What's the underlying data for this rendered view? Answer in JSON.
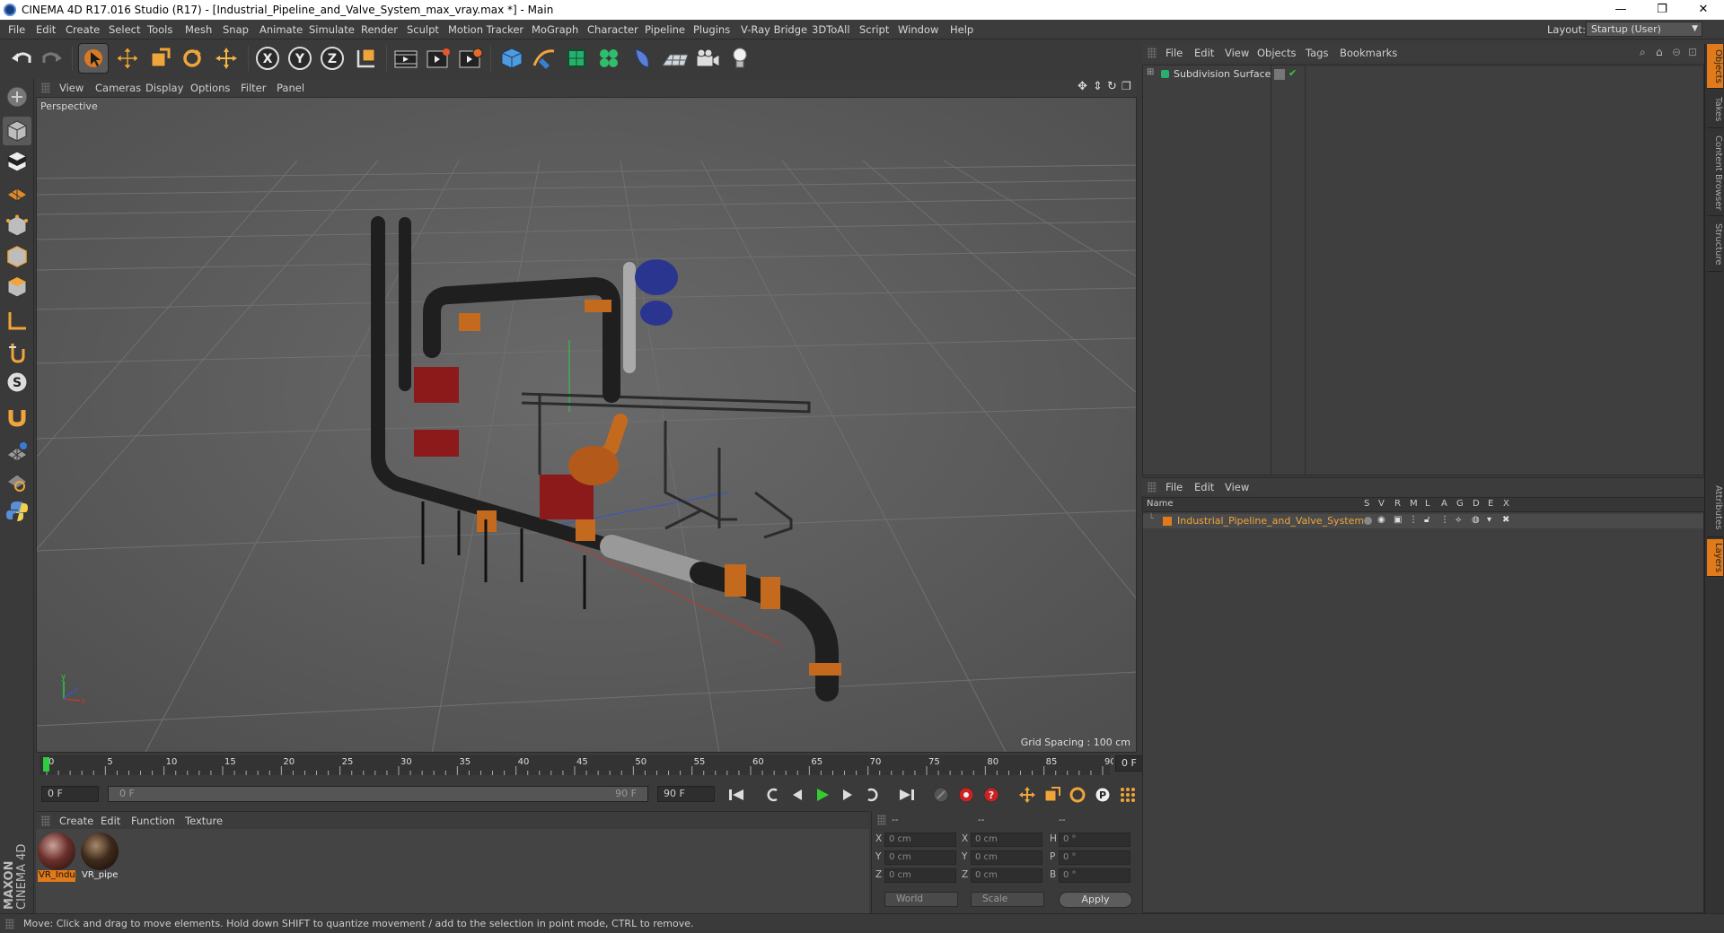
{
  "window": {
    "title": "CINEMA 4D R17.016 Studio (R17) - [Industrial_Pipeline_and_Valve_System_max_vray.max *] - Main",
    "minimize": "—",
    "restore": "❐",
    "close": "✕"
  },
  "menubar": {
    "items": [
      "File",
      "Edit",
      "Create",
      "Select",
      "Tools",
      "Mesh",
      "Snap",
      "Animate",
      "Simulate",
      "Render",
      "Sculpt",
      "Motion Tracker",
      "MoGraph",
      "Character",
      "Pipeline",
      "Plugins",
      "V-Ray Bridge",
      "3DToAll",
      "Script",
      "Window",
      "Help"
    ],
    "layout_label": "Layout:",
    "layout_value": "Startup (User)"
  },
  "toolbar": {
    "icons": [
      "undo-icon",
      "redo-icon",
      "select-arrow-icon",
      "move-icon",
      "scale-icon",
      "rotate-icon",
      "live-selection-icon",
      "x-axis-icon",
      "y-axis-icon",
      "z-axis-icon",
      "coordinate-system-icon",
      "render-view-icon",
      "render-picture-viewer-icon",
      "edit-render-settings-icon",
      "cube-icon",
      "pen-spline-icon",
      "subdivision-nurbs-icon",
      "cloner-icon",
      "deformer-icon",
      "floor-environment-icon",
      "camera-icon",
      "light-icon"
    ],
    "axis_labels": [
      "X",
      "Y",
      "Z"
    ]
  },
  "viewport": {
    "menu": [
      "View",
      "Cameras",
      "Display",
      "Options",
      "Filter",
      "Panel"
    ],
    "camera_label": "Perspective",
    "grid_spacing": "Grid Spacing : 100 cm"
  },
  "timeline": {
    "ticks": [
      "0",
      "5",
      "10",
      "15",
      "20",
      "25",
      "30",
      "35",
      "40",
      "45",
      "50",
      "55",
      "60",
      "65",
      "70",
      "75",
      "80",
      "85",
      "90"
    ],
    "current_frame_right": "0 F",
    "start_frame": "0 F",
    "range_start": "0 F",
    "range_end": "90 F",
    "end_frame": "90 F"
  },
  "materials": {
    "menu": [
      "Create",
      "Edit",
      "Function",
      "Texture"
    ],
    "items": [
      {
        "label": "VR_Indu",
        "color": "#6b2f2a"
      },
      {
        "label": "VR_pipe",
        "color": "#3e2a1c"
      }
    ]
  },
  "coordinates": {
    "headers": [
      "--",
      "--",
      "--"
    ],
    "rows": [
      {
        "l1": "X",
        "v1": "0 cm",
        "l2": "X",
        "v2": "0 cm",
        "l3": "H",
        "v3": "0 °"
      },
      {
        "l1": "Y",
        "v1": "0 cm",
        "l2": "Y",
        "v2": "0 cm",
        "l3": "P",
        "v3": "0 °"
      },
      {
        "l1": "Z",
        "v1": "0 cm",
        "l2": "Z",
        "v2": "0 cm",
        "l3": "B",
        "v3": "0 °"
      }
    ],
    "world": "World",
    "scale": "Scale",
    "apply": "Apply"
  },
  "objects_panel": {
    "menu": [
      "File",
      "Edit",
      "View",
      "Objects",
      "Tags",
      "Bookmarks"
    ],
    "items": [
      {
        "name": "Subdivision Surface"
      }
    ]
  },
  "layers_panel": {
    "menu": [
      "File",
      "Edit",
      "View"
    ],
    "columns": [
      "Name",
      "S",
      "V",
      "R",
      "M",
      "L",
      "A",
      "G",
      "D",
      "E",
      "X"
    ],
    "items": [
      {
        "name": "Industrial_Pipeline_and_Valve_System",
        "color": "#e07a1a"
      }
    ]
  },
  "side_tabs": [
    "Objects",
    "Takes",
    "Content Browser",
    "Structure",
    "Attributes",
    "Layers"
  ],
  "status": {
    "text": "Move: Click and drag to move elements. Hold down SHIFT to quantize movement / add to the selection in point mode, CTRL to remove."
  },
  "brand": {
    "line1": "MAXON",
    "line2": "CINEMA 4D"
  },
  "colors": {
    "accent": "#e07a1a",
    "active_frame": "#2ecc40",
    "play": "#33cc33"
  }
}
